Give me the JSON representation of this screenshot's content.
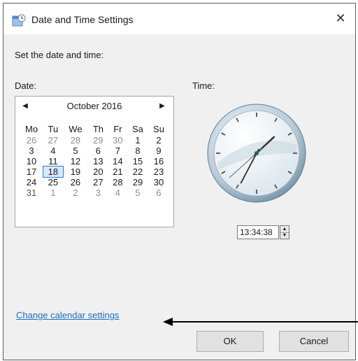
{
  "window": {
    "title": "Date and Time Settings",
    "close_glyph": "✕"
  },
  "content": {
    "heading": "Set the date and time:",
    "date_label": "Date:",
    "time_label": "Time:"
  },
  "calendar": {
    "prev_glyph": "◀",
    "next_glyph": "▶",
    "month_year": "October 2016",
    "weekdays": [
      "Mo",
      "Tu",
      "We",
      "Th",
      "Fr",
      "Sa",
      "Su"
    ],
    "weeks": [
      [
        "26",
        "27",
        "28",
        "29",
        "30",
        "1",
        "2"
      ],
      [
        "3",
        "4",
        "5",
        "6",
        "7",
        "8",
        "9"
      ],
      [
        "10",
        "11",
        "12",
        "13",
        "14",
        "15",
        "16"
      ],
      [
        "17",
        "18",
        "19",
        "20",
        "21",
        "22",
        "23"
      ],
      [
        "24",
        "25",
        "26",
        "27",
        "28",
        "29",
        "30"
      ],
      [
        "31",
        "1",
        "2",
        "3",
        "4",
        "5",
        "6"
      ]
    ],
    "selected_day": "18"
  },
  "time": {
    "value": "13:34:38",
    "hour": 13,
    "minute": 34,
    "second": 38,
    "spin_up": "▲",
    "spin_down": "▼"
  },
  "links": {
    "calendar_settings": "Change calendar settings"
  },
  "buttons": {
    "ok": "OK",
    "cancel": "Cancel"
  },
  "colors": {
    "link": "#1a6ec2",
    "selection": "#2b7ad1",
    "content_bg": "#f0f0f0"
  },
  "icons": {
    "title": "date-time-icon",
    "close": "close-icon"
  }
}
